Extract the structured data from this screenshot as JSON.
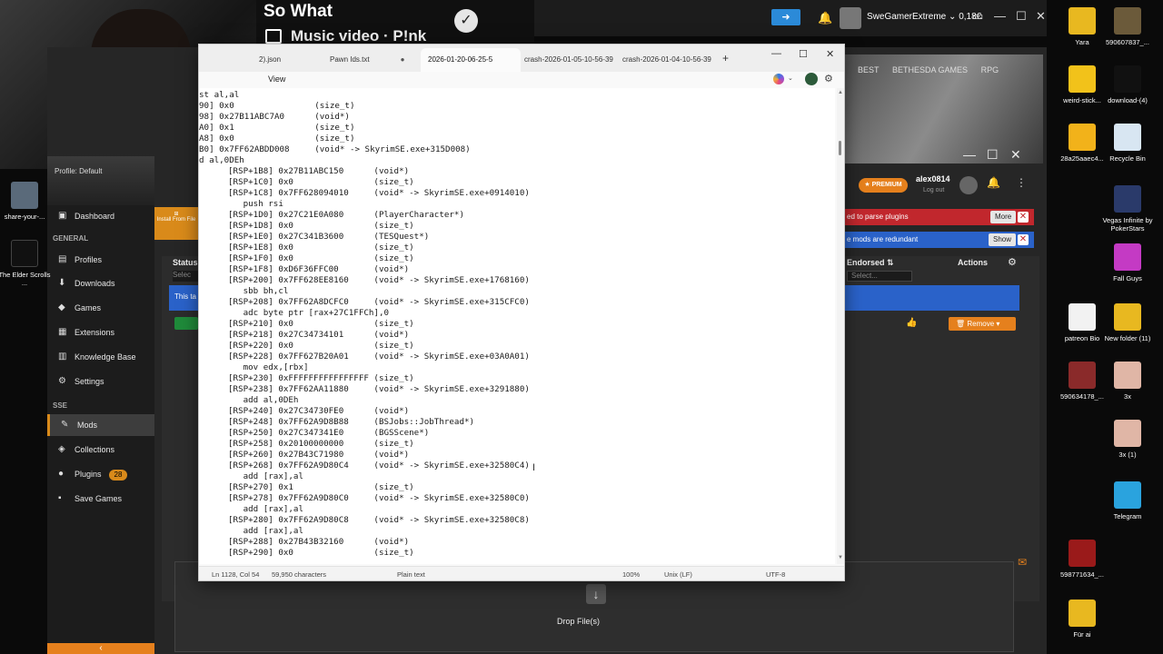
{
  "overlay": {
    "song_title": "So What",
    "song_subtitle": "Music video · P!nk"
  },
  "vortex": {
    "username": "SweGamerExtreme",
    "balance": "0,18€",
    "links": [
      "BEST",
      "BETHESDA GAMES",
      "RPG"
    ],
    "profile_label": "Profile: Default",
    "install_button": "Install From File",
    "sidebar": {
      "top_items": [
        {
          "label": "Dashboard",
          "icon": "dashboard-icon"
        }
      ],
      "general_header": "GENERAL",
      "general_items": [
        {
          "label": "Profiles",
          "icon": "profiles-icon"
        },
        {
          "label": "Downloads",
          "icon": "download-icon"
        },
        {
          "label": "Games",
          "icon": "gamepad-icon"
        },
        {
          "label": "Extensions",
          "icon": "extensions-icon"
        },
        {
          "label": "Knowledge Base",
          "icon": "book-icon"
        },
        {
          "label": "Settings",
          "icon": "gear-icon"
        }
      ],
      "sse_header": "SSE",
      "sse_items": [
        {
          "label": "Mods",
          "icon": "wrench-icon"
        },
        {
          "label": "Collections",
          "icon": "collections-icon"
        },
        {
          "label": "Plugins",
          "icon": "plugins-icon",
          "badge": "28"
        },
        {
          "label": "Save Games",
          "icon": "save-icon"
        }
      ]
    },
    "premium": "★ PREMIUM",
    "account_name": "alex0814",
    "logout": "Log out",
    "notifications": [
      {
        "text": "ed to parse plugins",
        "button": "More",
        "color": "#c1272d"
      },
      {
        "text": "e mods are redundant",
        "button": "Show",
        "color": "#2a62c9"
      }
    ],
    "status_label": "Status",
    "status_select": "Selec",
    "info_text": "This ta",
    "endorsed_label": "Endorsed ⇅",
    "endorsed_select": "Select...",
    "actions_label": "Actions",
    "remove_button": "Remove",
    "drop_label": "Drop File(s)",
    "accent": "#e5801d"
  },
  "notepad": {
    "tabs": [
      {
        "label": "2).json",
        "active": false
      },
      {
        "label": "Pawn Ids.txt",
        "active": false,
        "modified": true
      },
      {
        "label": "2026-01-20-06-25-5",
        "active": true
      },
      {
        "label": "crash-2026-01-05-10-56-39",
        "active": false
      },
      {
        "label": "crash-2026-01-04-10-56-39",
        "active": false
      }
    ],
    "menu_view": "View",
    "lines": [
      "st al,al",
      "90] 0x0                (size_t)",
      "98] 0x27B11ABC7A0      (void*)",
      "A0] 0x1                (size_t)",
      "A8] 0x0                (size_t)",
      "B0] 0x7FF62ABDD008     (void* -> SkyrimSE.exe+315D008)",
      "d al,0DEh",
      "[RSP+1B8] 0x27B11ABC150      (void*)",
      "[RSP+1C0] 0x0                (size_t)",
      "[RSP+1C8] 0x7FF628094010     (void* -> SkyrimSE.exe+0914010)",
      "   push rsi",
      "[RSP+1D0] 0x27C21E0A080      (PlayerCharacter*)",
      "[RSP+1D8] 0x0                (size_t)",
      "[RSP+1E0] 0x27C341B3600      (TESQuest*)",
      "[RSP+1E8] 0x0                (size_t)",
      "[RSP+1F0] 0x0                (size_t)",
      "[RSP+1F8] 0xD6F36FFC00       (void*)",
      "[RSP+200] 0x7FF628EE8160     (void* -> SkyrimSE.exe+1768160)",
      "   sbb bh,cl",
      "[RSP+208] 0x7FF62A8DCFC0     (void* -> SkyrimSE.exe+315CFC0)",
      "   adc byte ptr [rax+27C1FFCh],0",
      "[RSP+210] 0x0                (size_t)",
      "[RSP+218] 0x27C34734101      (void*)",
      "[RSP+220] 0x0                (size_t)",
      "[RSP+228] 0x7FF627B20A01     (void* -> SkyrimSE.exe+03A0A01)",
      "   mov edx,[rbx]",
      "[RSP+230] 0xFFFFFFFFFFFFFFFF (size_t)",
      "[RSP+238] 0x7FF62AA11880     (void* -> SkyrimSE.exe+3291880)",
      "   add al,0DEh",
      "[RSP+240] 0x27C34730FE0      (void*)",
      "[RSP+248] 0x7FF62A9D8B88     (BSJobs::JobThread*)",
      "[RSP+250] 0x27C347341E0      (BGSScene*)",
      "[RSP+258] 0x20100000000      (size_t)",
      "[RSP+260] 0x27B43C71980      (void*)",
      "[RSP+268] 0x7FF62A9D80C4     (void* -> SkyrimSE.exe+32580C4)",
      "   add [rax],al",
      "[RSP+270] 0x1                (size_t)",
      "[RSP+278] 0x7FF62A9D80C0     (void* -> SkyrimSE.exe+32580C0)",
      "   add [rax],al",
      "[RSP+280] 0x7FF62A9D80C8     (void* -> SkyrimSE.exe+32580C8)",
      "   add [rax],al",
      "[RSP+288] 0x27B43B32160      (void*)",
      "[RSP+290] 0x0                (size_t)"
    ],
    "status": {
      "position": "Ln 1128, Col 54",
      "chars": "59,950 characters",
      "format": "Plain text",
      "zoom": "100%",
      "eol": "Unix (LF)",
      "encoding": "UTF-8"
    }
  },
  "desktop_icons_left": [
    {
      "label": "share-your-..."
    },
    {
      "label": "The Elder Scrolls ..."
    }
  ],
  "desktop_icons_right": [
    {
      "label": "Yara",
      "color": "#e8b820"
    },
    {
      "label": "590607837_...",
      "color": "#6b5a3a"
    },
    {
      "label": "weird-stick...",
      "color": "#f2c21a"
    },
    {
      "label": "download-(4)",
      "color": "#111111"
    },
    {
      "label": "28a25aaec4...",
      "color": "#f2b21a"
    },
    {
      "label": "Recycle Bin",
      "color": "#d8e6f2"
    },
    {
      "label": "Vegas Infinite by PokerStars",
      "color": "#2a3a6a"
    },
    {
      "label": "Fall Guys",
      "color": "#c43ac4"
    },
    {
      "label": "patreon Bio",
      "color": "#f2f2f2"
    },
    {
      "label": "New folder (11)",
      "color": "#e8b820"
    },
    {
      "label": "590634178_...",
      "color": "#8a2a2a"
    },
    {
      "label": "3x",
      "color": "#e0b6a6"
    },
    {
      "label": "3x (1)",
      "color": "#e0b6a6"
    },
    {
      "label": "Telegram",
      "color": "#2aa3de"
    },
    {
      "label": "598771634_...",
      "color": "#9a1a1a"
    },
    {
      "label": "Für ai",
      "color": "#e8b820"
    }
  ]
}
